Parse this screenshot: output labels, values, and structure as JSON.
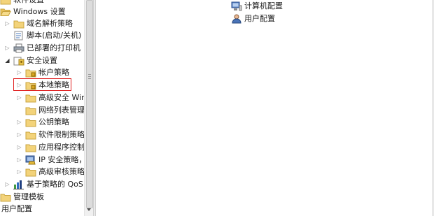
{
  "tree": {
    "items": [
      {
        "label": "软件设置"
      },
      {
        "label": "Windows 设置"
      },
      {
        "label": "域名解析策略"
      },
      {
        "label": "脚本(启动/关机)"
      },
      {
        "label": "已部署的打印机"
      },
      {
        "label": "安全设置"
      },
      {
        "label": "帐户策略"
      },
      {
        "label": "本地策略"
      },
      {
        "label": "高级安全 Win"
      },
      {
        "label": "网络列表管理"
      },
      {
        "label": "公钥策略"
      },
      {
        "label": "软件限制策略"
      },
      {
        "label": "应用程序控制"
      },
      {
        "label": "IP 安全策略，"
      },
      {
        "label": "高级审核策略"
      },
      {
        "label": "基于策略的 QoS"
      },
      {
        "label": "管理模板"
      },
      {
        "label": "用户配置"
      }
    ]
  },
  "right_pane": {
    "items": [
      {
        "label": "计算机配置"
      },
      {
        "label": "用户配置"
      }
    ]
  }
}
